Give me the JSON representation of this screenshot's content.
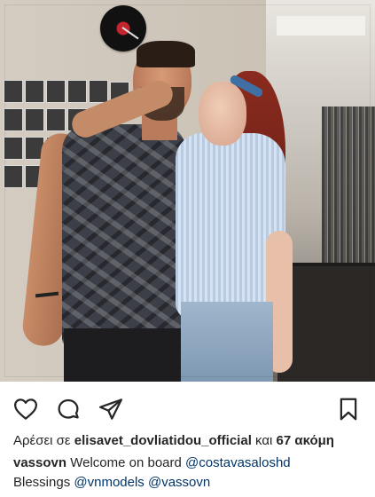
{
  "post": {
    "likes": {
      "prefix": "Αρέσει σε",
      "user": "elisavet_dovliatidou_official",
      "connector": "και",
      "others": "67 ακόμη"
    },
    "caption": {
      "username": "vassovn",
      "line1_text": "Welcome on board",
      "line1_mention": "@costavasaloshd",
      "line2_text": "Blessings",
      "line2_mention1": "@vnmodels",
      "line2_mention2": "@vassovn"
    }
  },
  "actions": {
    "like_icon": "heart-outline-icon",
    "comment_icon": "comment-bubble-icon",
    "share_icon": "paper-plane-icon",
    "save_icon": "bookmark-icon"
  },
  "colors": {
    "text": "#262626",
    "mention": "#003569",
    "background": "#ffffff"
  }
}
